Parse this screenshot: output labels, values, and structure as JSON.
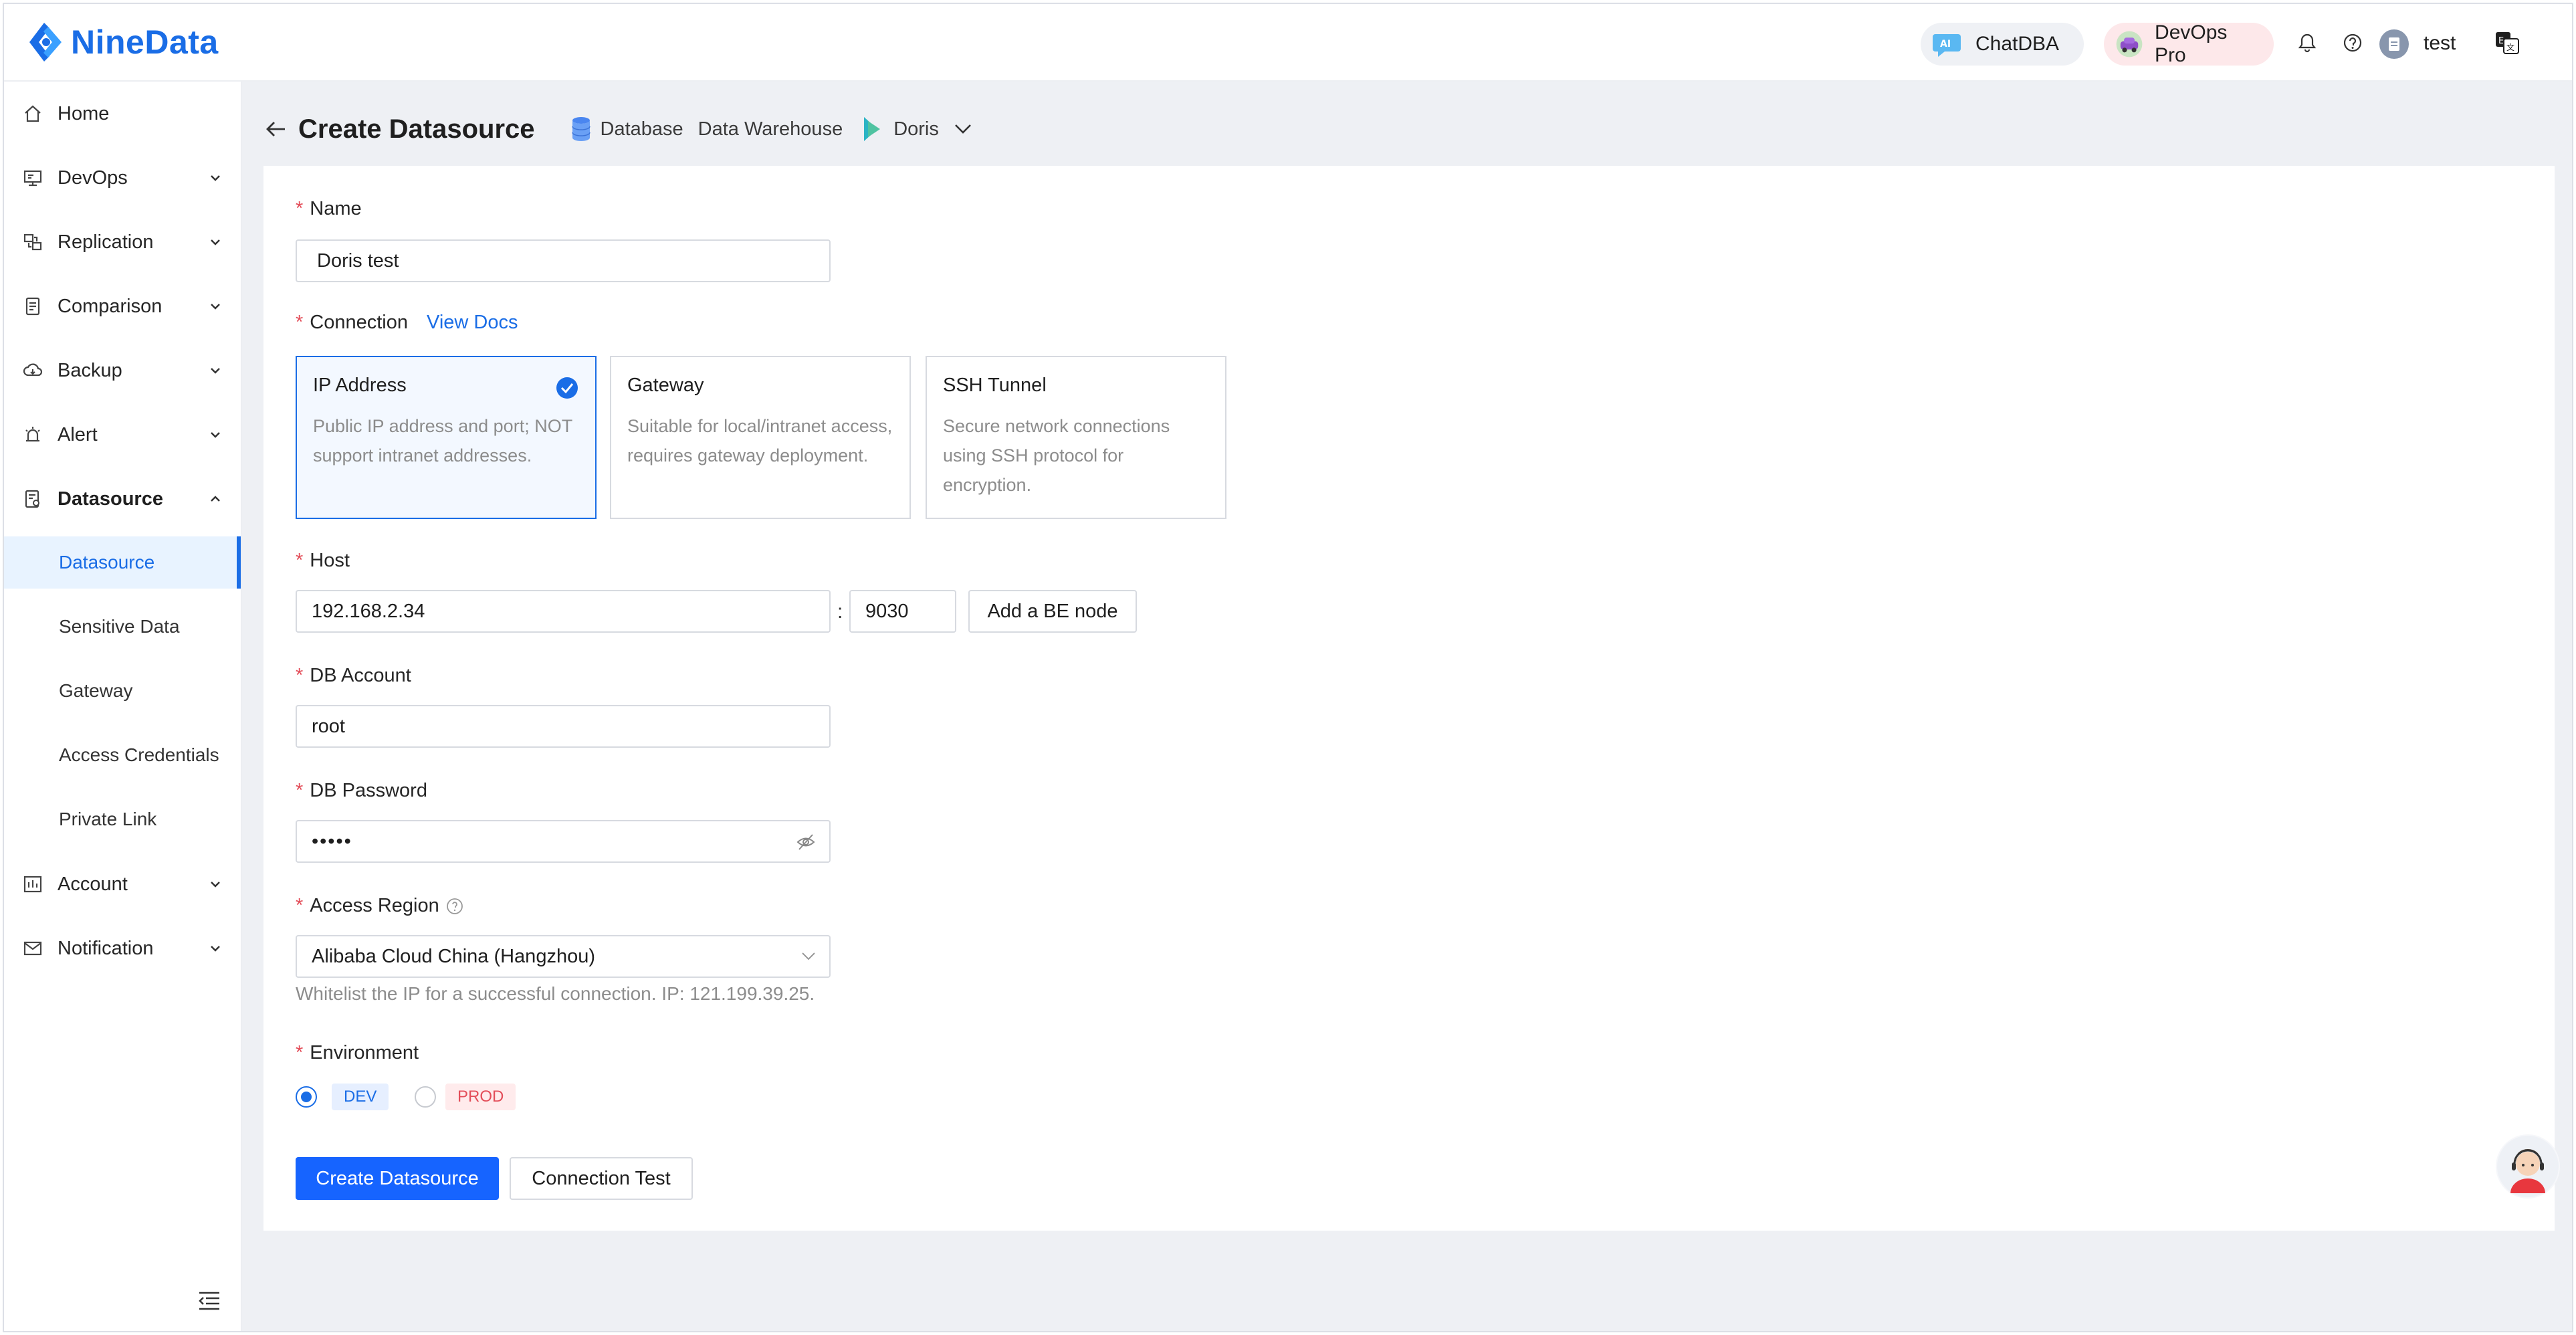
{
  "app": {
    "logo_text": "NineData"
  },
  "header": {
    "chatdba_label": "ChatDBA",
    "devops_label": "DevOps Pro",
    "user_name": "test"
  },
  "sidebar": {
    "items": [
      {
        "label": "Home"
      },
      {
        "label": "DevOps"
      },
      {
        "label": "Replication"
      },
      {
        "label": "Comparison"
      },
      {
        "label": "Backup"
      },
      {
        "label": "Alert"
      },
      {
        "label": "Datasource"
      },
      {
        "label": "Account"
      },
      {
        "label": "Notification"
      }
    ],
    "sub_items": [
      {
        "label": "Datasource"
      },
      {
        "label": "Sensitive Data"
      },
      {
        "label": "Gateway"
      },
      {
        "label": "Access Credentials"
      },
      {
        "label": "Private Link"
      }
    ]
  },
  "page": {
    "title": "Create Datasource",
    "breadcrumb": [
      "Database",
      "Data Warehouse",
      "Doris"
    ]
  },
  "form": {
    "name": {
      "label": "Name",
      "value": "Doris test"
    },
    "connection": {
      "label": "Connection",
      "docs_link": "View Docs",
      "options": [
        {
          "title": "IP Address",
          "desc": "Public IP address and port; NOT support intranet addresses."
        },
        {
          "title": "Gateway",
          "desc": "Suitable for local/intranet access, requires gateway deployment."
        },
        {
          "title": "SSH Tunnel",
          "desc": "Secure network connections using SSH protocol for encryption."
        }
      ],
      "selected": "IP Address"
    },
    "host": {
      "label": "Host",
      "value": "192.168.2.34",
      "separator": ":",
      "port": "9030",
      "add_be_label": "Add a BE node"
    },
    "account": {
      "label": "DB Account",
      "value": "root"
    },
    "password": {
      "label": "DB Password",
      "value": "•••••"
    },
    "region": {
      "label": "Access Region",
      "value": "Alibaba Cloud China (Hangzhou)",
      "help": "Whitelist the IP for a successful connection. IP: 121.199.39.25."
    },
    "environment": {
      "label": "Environment",
      "options": [
        "DEV",
        "PROD"
      ],
      "selected": "DEV"
    },
    "create_button": "Create Datasource",
    "test_button": "Connection Test"
  },
  "colors": {
    "primary": "#1664ff",
    "link": "#1a6de6",
    "required": "#e34d59",
    "bg": "#eef0f4"
  }
}
